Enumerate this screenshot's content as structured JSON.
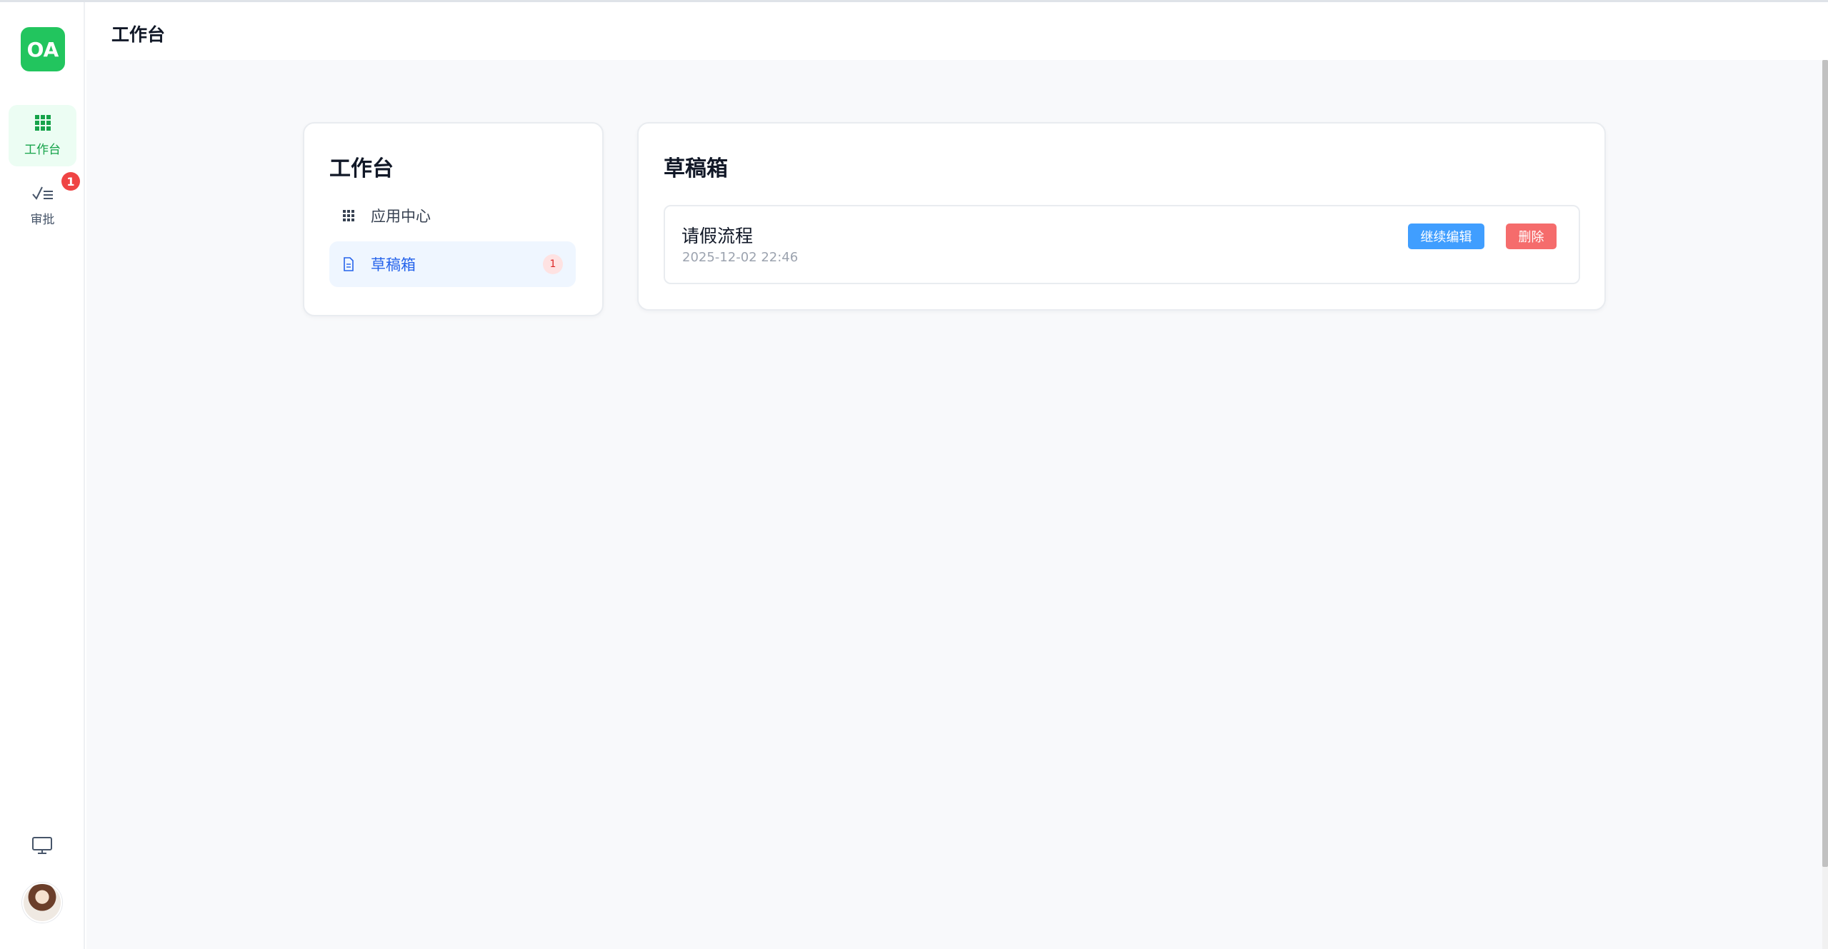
{
  "app": {
    "logo_text": "OA",
    "brand_color": "#22c55e"
  },
  "rail": {
    "items": [
      {
        "label": "工作台",
        "icon": "grid-icon",
        "active": true
      },
      {
        "label": "审批",
        "icon": "approval-checklist-icon",
        "badge": "1"
      }
    ],
    "bottom_icons": [
      "monitor-icon",
      "avatar"
    ]
  },
  "header": {
    "title": "工作台"
  },
  "left_panel": {
    "title": "工作台",
    "menu": [
      {
        "label": "应用中心",
        "icon": "grid-icon"
      },
      {
        "label": "草稿箱",
        "icon": "document-icon",
        "count": "1",
        "active": true
      }
    ]
  },
  "drafts": {
    "title": "草稿箱",
    "items": [
      {
        "name": "请假流程",
        "time": "2025-12-02 22:46",
        "edit_label": "继续编辑",
        "delete_label": "删除"
      }
    ]
  },
  "colors": {
    "primary_button": "#409eff",
    "danger_button": "#f56c6c",
    "badge_red": "#ef4444",
    "active_green": "#16a34a",
    "active_blue": "#2563eb"
  }
}
